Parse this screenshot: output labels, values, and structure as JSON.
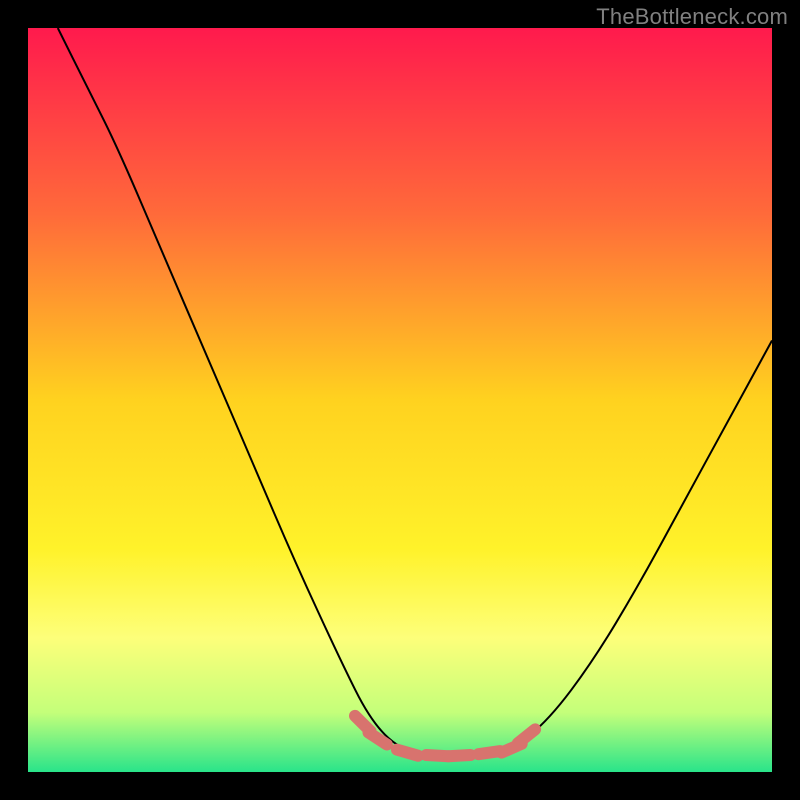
{
  "watermark": "TheBottleneck.com",
  "chart_data": {
    "type": "line",
    "title": "",
    "xlabel": "",
    "ylabel": "",
    "xlim": [
      0,
      100
    ],
    "ylim": [
      0,
      100
    ],
    "background_gradient": {
      "stops": [
        {
          "offset": 0,
          "color": "#ff1a4d"
        },
        {
          "offset": 25,
          "color": "#ff6a3a"
        },
        {
          "offset": 50,
          "color": "#ffd21f"
        },
        {
          "offset": 70,
          "color": "#fff22a"
        },
        {
          "offset": 82,
          "color": "#fdff7a"
        },
        {
          "offset": 92,
          "color": "#c4ff7a"
        },
        {
          "offset": 100,
          "color": "#29e48a"
        }
      ]
    },
    "series": [
      {
        "name": "bottleneck-curve",
        "color": "#000000",
        "points": [
          {
            "x": 4,
            "y": 100
          },
          {
            "x": 8,
            "y": 92
          },
          {
            "x": 12,
            "y": 84
          },
          {
            "x": 18,
            "y": 70
          },
          {
            "x": 24,
            "y": 56
          },
          {
            "x": 30,
            "y": 42
          },
          {
            "x": 36,
            "y": 28
          },
          {
            "x": 42,
            "y": 15
          },
          {
            "x": 46,
            "y": 7
          },
          {
            "x": 50,
            "y": 3
          },
          {
            "x": 55,
            "y": 2
          },
          {
            "x": 60,
            "y": 2
          },
          {
            "x": 65,
            "y": 3
          },
          {
            "x": 70,
            "y": 7
          },
          {
            "x": 76,
            "y": 15
          },
          {
            "x": 82,
            "y": 25
          },
          {
            "x": 88,
            "y": 36
          },
          {
            "x": 94,
            "y": 47
          },
          {
            "x": 100,
            "y": 58
          }
        ]
      }
    ],
    "markers": {
      "name": "min-region-dashes",
      "color": "#d8736e",
      "points": [
        {
          "x": 45,
          "y": 6.5
        },
        {
          "x": 47,
          "y": 4.5
        },
        {
          "x": 51,
          "y": 2.6
        },
        {
          "x": 55,
          "y": 2.2
        },
        {
          "x": 58,
          "y": 2.2
        },
        {
          "x": 62,
          "y": 2.6
        },
        {
          "x": 65,
          "y": 3.2
        },
        {
          "x": 67,
          "y": 4.8
        }
      ]
    }
  }
}
